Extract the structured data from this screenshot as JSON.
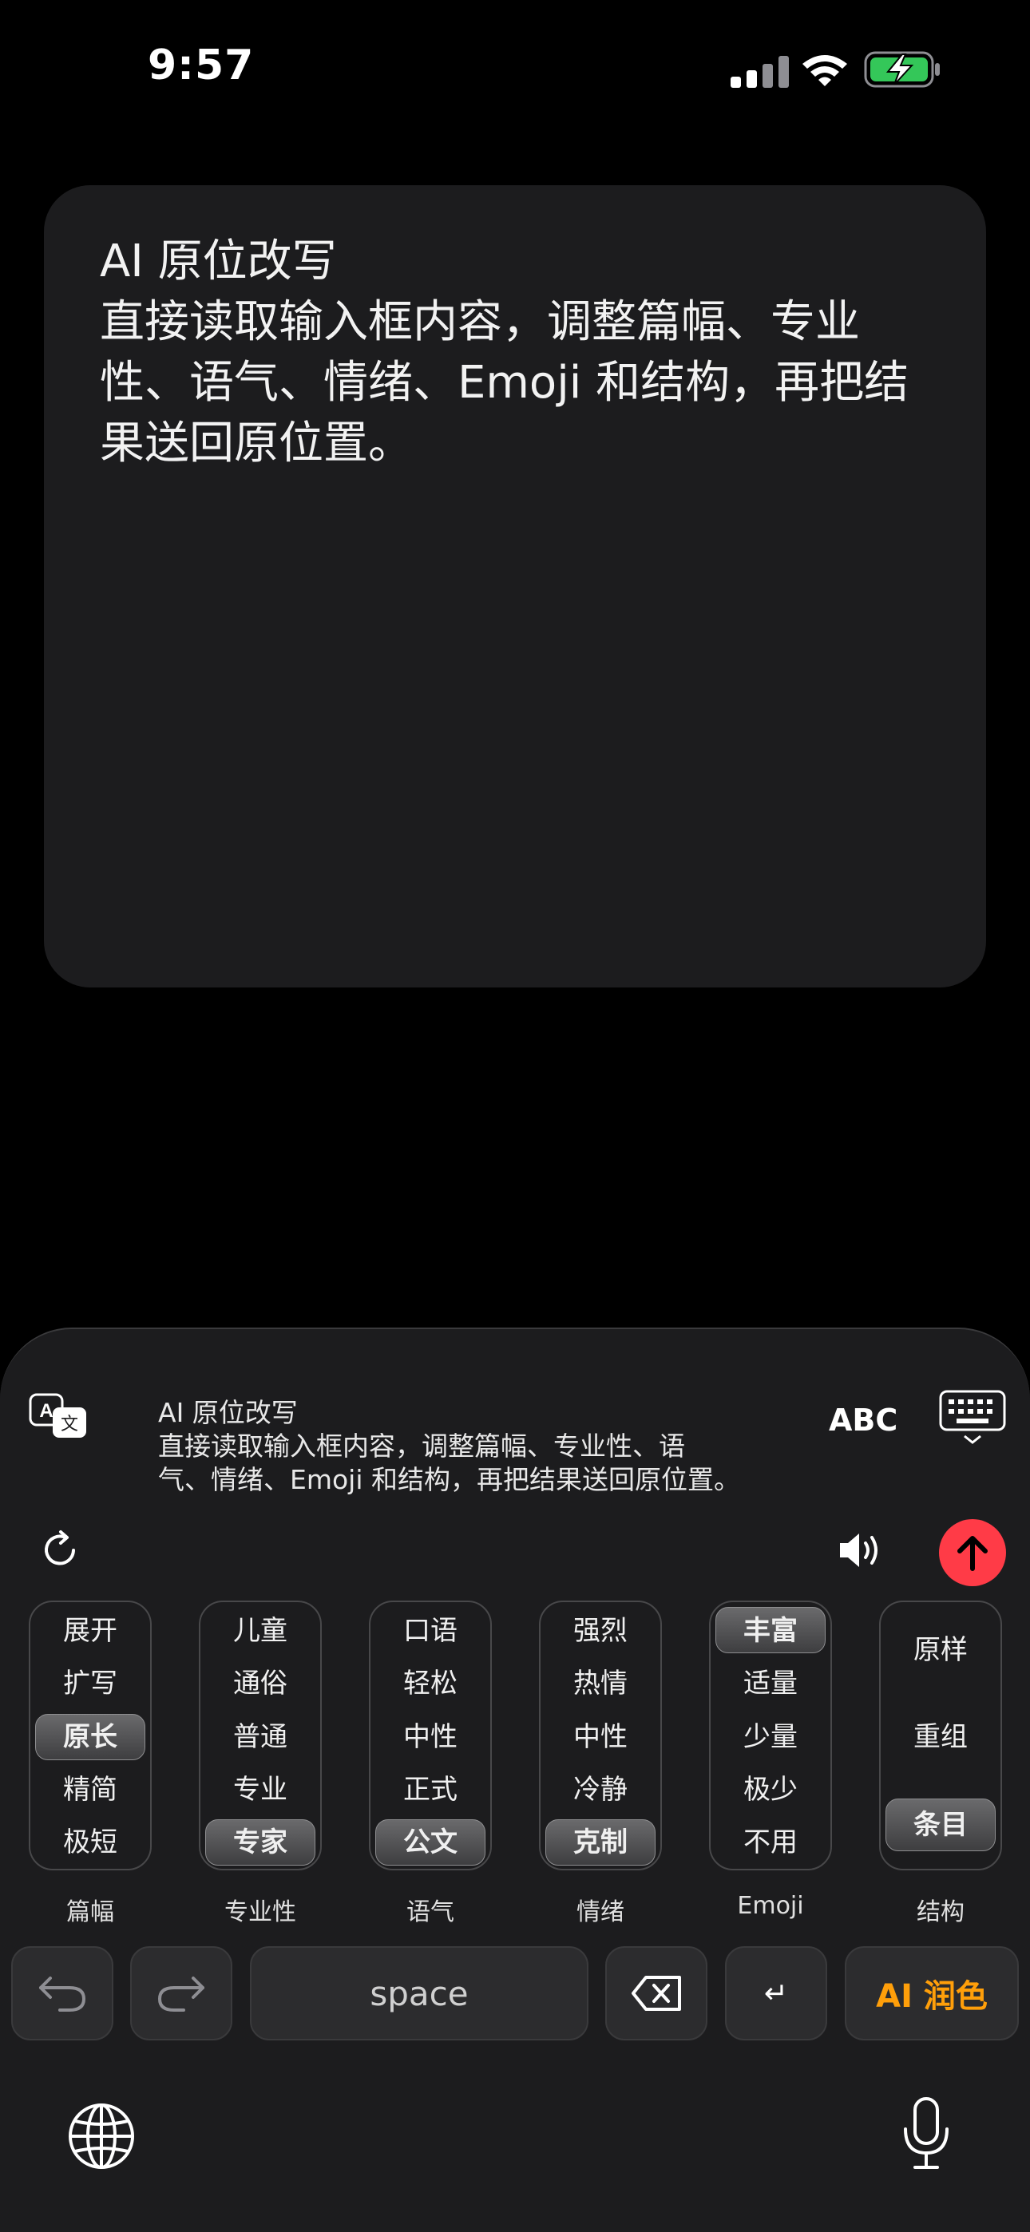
{
  "status_bar": {
    "time": "9:57"
  },
  "card": {
    "title": "AI 原位改写",
    "body_lines": [
      "直接读取输入框内容，调整篇幅、专业",
      "性、语气、情绪、Emoji 和结构，再把结",
      "果送回原位置。"
    ]
  },
  "keyboard": {
    "preview_lines": [
      "AI 原位改写",
      "直接读取输入框内容，调整篇幅、专业性、语",
      "气、情绪、Emoji 和结构，再把结果送回原位置。"
    ],
    "abc_label": "ABC",
    "pickers": [
      {
        "label": "篇幅",
        "options": [
          "展开",
          "扩写",
          "原长",
          "精简",
          "极短"
        ],
        "selected": "原长"
      },
      {
        "label": "专业性",
        "options": [
          "儿童",
          "通俗",
          "普通",
          "专业",
          "专家"
        ],
        "selected": "专家"
      },
      {
        "label": "语气",
        "options": [
          "口语",
          "轻松",
          "中性",
          "正式",
          "公文"
        ],
        "selected": "公文"
      },
      {
        "label": "情绪",
        "options": [
          "强烈",
          "热情",
          "中性",
          "冷静",
          "克制"
        ],
        "selected": "克制"
      },
      {
        "label": "Emoji",
        "options": [
          "丰富",
          "适量",
          "少量",
          "极少",
          "不用"
        ],
        "selected": "丰富"
      },
      {
        "label": "结构",
        "options": [
          "原样",
          "重组",
          "条目"
        ],
        "selected": "条目"
      }
    ],
    "space_label": "space",
    "return_label": "↵",
    "ai_button_label": "AI 润色"
  },
  "colors": {
    "accent_orange": "#ff9f0a",
    "send_red": "#ff3b47",
    "battery_green": "#34c759"
  },
  "icons": [
    "signal-icon",
    "wifi-icon",
    "battery-charging-icon",
    "translate-icon",
    "keyboard-icon",
    "refresh-icon",
    "speaker-icon",
    "send-arrow-icon",
    "undo-icon",
    "redo-icon",
    "backspace-icon",
    "globe-icon",
    "microphone-icon"
  ]
}
